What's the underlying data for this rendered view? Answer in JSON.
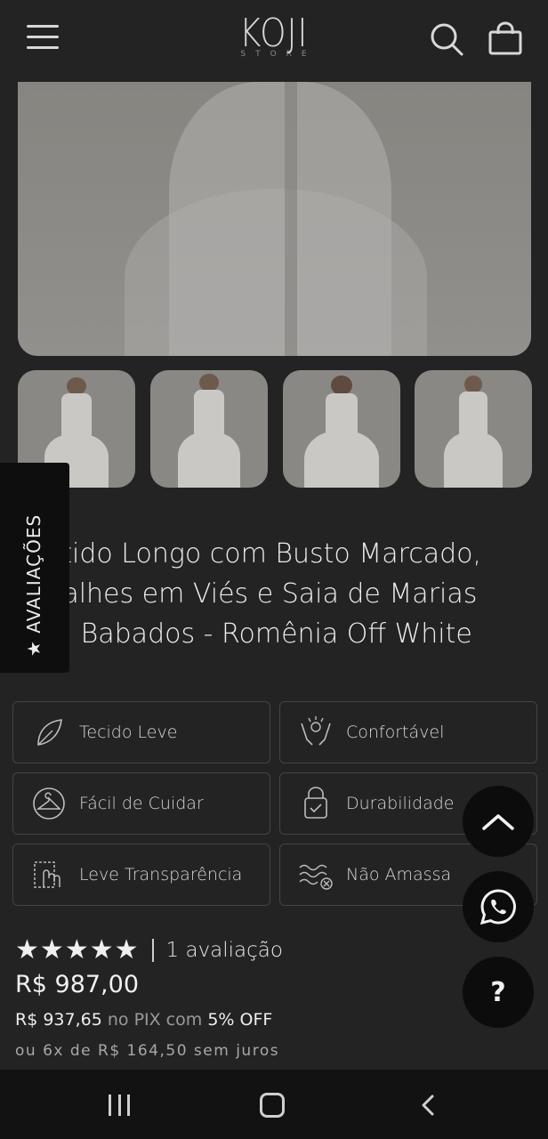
{
  "header": {
    "logo_main": "KOJI",
    "logo_sub": "STORE",
    "menu_icon": "hamburger-menu-icon",
    "search_icon": "search-icon",
    "bag_icon": "shopping-bag-icon"
  },
  "reviews_tab": {
    "label": "★ AVALIAÇÕES"
  },
  "product": {
    "title": "Vestido Longo com Busto Marcado, Detalhes em Viés e Saia de Marias com Babados - Romênia Off White",
    "features": [
      {
        "label": "Tecido Leve",
        "icon": "leaf-icon"
      },
      {
        "label": "Confortável",
        "icon": "comfort-hands-icon"
      },
      {
        "label": "Fácil de Cuidar",
        "icon": "hanger-icon"
      },
      {
        "label": "Durabilidade",
        "icon": "lock-shield-icon"
      },
      {
        "label": "Leve Transparência",
        "icon": "transparency-icon"
      },
      {
        "label": "Não Amassa",
        "icon": "no-wrinkle-icon"
      }
    ],
    "rating": {
      "stars": 5,
      "count_label": "1 avaliação"
    },
    "price": "R$ 987,00",
    "pix": {
      "price": "R$ 937,65",
      "mid": "no PIX com",
      "discount": "5% OFF"
    },
    "installments": "ou 6x de R$ 164,50 sem juros"
  },
  "floating": {
    "top_icon": "chevron-up-icon",
    "whatsapp_icon": "whatsapp-icon",
    "help_label": "?"
  },
  "navbar": {
    "recent_icon": "recent-apps-icon",
    "home_icon": "home-icon",
    "back_icon": "back-icon"
  }
}
